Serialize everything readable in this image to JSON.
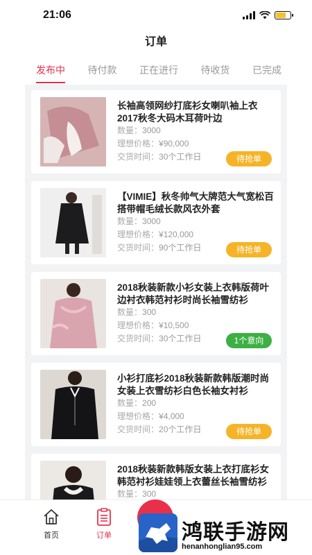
{
  "status": {
    "time": "21:06"
  },
  "nav": {
    "title": "订单"
  },
  "tabs": [
    {
      "label": "发布中",
      "active": true
    },
    {
      "label": "待付款",
      "active": false
    },
    {
      "label": "正在进行",
      "active": false
    },
    {
      "label": "待收货",
      "active": false
    },
    {
      "label": "已完成",
      "active": false
    }
  ],
  "labels": {
    "quantity": "数量：",
    "price": "理想价格：",
    "delivery": "交货时间："
  },
  "orders": [
    {
      "title": "长袖高领网纱打底衫女喇叭袖上衣2017秋冬大码木耳荷叶边",
      "quantity": "3000",
      "price": "¥90,000",
      "delivery": "30个工作日",
      "action": "待抢单",
      "action_color": "#f5b428"
    },
    {
      "title": "【VIMIE】秋冬帅气大牌范大气宽松百搭带帽毛绒长款风衣外套",
      "quantity": "3000",
      "price": "¥120,000",
      "delivery": "90个工作日",
      "action": "待抢单",
      "action_color": "#f5b428"
    },
    {
      "title": "2018秋装新款小衫女装上衣韩版荷叶边衬衣韩范衬衫时尚长袖雪纺衫",
      "quantity": "300",
      "price": "¥10,500",
      "delivery": "30个工作日",
      "action": "1个意向",
      "action_color": "#3cb043"
    },
    {
      "title": "小衫打底衫2018秋装新款韩版潮时尚女装上衣雪纺衫白色长袖女衬衫",
      "quantity": "200",
      "price": "¥4,000",
      "delivery": "20个工作日",
      "action": "待抢单",
      "action_color": "#f5b428"
    },
    {
      "title": "2018秋装新款韩版女装上衣打底衫女韩范衬衫娃娃领上衣蕾丝长袖雪纺衫",
      "quantity": "300"
    }
  ],
  "tabbar": [
    {
      "label": "首页",
      "icon": "home-icon",
      "active": false
    },
    {
      "label": "订单",
      "icon": "order-icon",
      "active": true
    }
  ],
  "watermark": {
    "title": "鸿联手游网",
    "url": "henanhonglian95.com"
  },
  "colors": {
    "accent": "#e8304a",
    "yellow_button": "#f5b428",
    "green_button": "#3cb043"
  }
}
